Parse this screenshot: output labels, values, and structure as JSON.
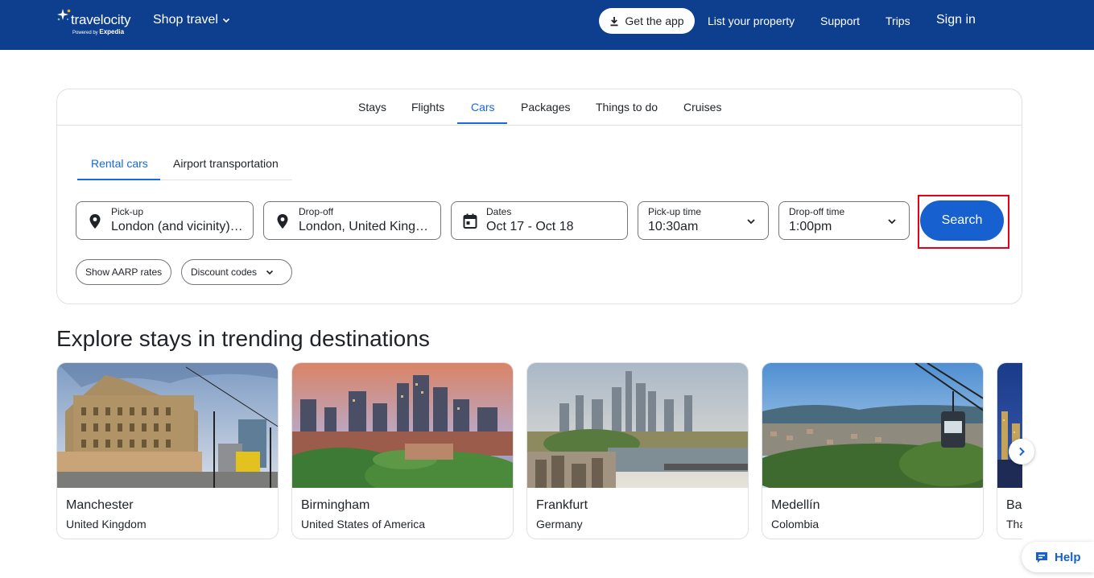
{
  "header": {
    "brand": "travelocity",
    "powered_by": "Powered by",
    "powered_brand": "Expedia",
    "shop_travel": "Shop travel",
    "get_app": "Get the app",
    "list_property": "List your property",
    "support": "Support",
    "trips": "Trips",
    "sign_in": "Sign in"
  },
  "search": {
    "tabs": [
      "Stays",
      "Flights",
      "Cars",
      "Packages",
      "Things to do",
      "Cruises"
    ],
    "active_tab": "Cars",
    "subtabs": [
      "Rental cars",
      "Airport transportation"
    ],
    "active_subtab": "Rental cars",
    "pickup": {
      "label": "Pick-up",
      "value": "London (and vicinity), England, United Kingdom"
    },
    "dropoff": {
      "label": "Drop-off",
      "value": "London, United Kingdom"
    },
    "dates": {
      "label": "Dates",
      "value": "Oct 17 - Oct 18"
    },
    "pickup_time": {
      "label": "Pick-up time",
      "value": "10:30am"
    },
    "dropoff_time": {
      "label": "Drop-off time",
      "value": "1:00pm"
    },
    "search_button": "Search",
    "aarp": "Show AARP rates",
    "discount": "Discount codes"
  },
  "explore": {
    "title": "Explore stays in trending destinations",
    "destinations": [
      {
        "city": "Manchester",
        "country": "United Kingdom"
      },
      {
        "city": "Birmingham",
        "country": "United States of America"
      },
      {
        "city": "Frankfurt",
        "country": "Germany"
      },
      {
        "city": "Medellín",
        "country": "Colombia"
      },
      {
        "city": "Bangkok",
        "country": "Thailand"
      }
    ]
  },
  "help": "Help",
  "colors": {
    "header_bg": "#0e3f8f",
    "accent": "#1668e3",
    "search_button": "#1660cf",
    "highlight": "#e2001a"
  },
  "icons": [
    "travelocity-star-icon",
    "chevron-down-icon",
    "download-icon",
    "location-pin-icon",
    "calendar-icon",
    "chevron-right-icon",
    "chat-icon"
  ]
}
